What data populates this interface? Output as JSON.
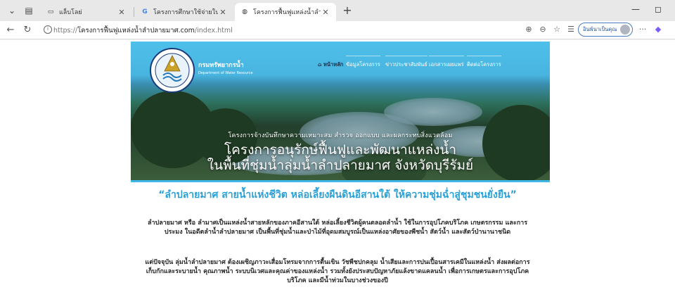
{
  "browser": {
    "tabs": [
      {
        "title": "แล็บโลย่",
        "active": false
      },
      {
        "title": "โครงการศึกษาใช้จ่ายในการศึกษาความเหมาะสม",
        "active": false
      },
      {
        "title": "โครงการฟื้นฟูแหล่งน้ำลำปลายมาศ",
        "active": true
      }
    ],
    "new_tab_glyph": "+",
    "url": {
      "scheme": "https://",
      "host": "โครงการฟื้นฟูแหล่งน้ำลำปลายมาศ.com",
      "path": "/index.html"
    },
    "profile_label": "อินพ้นาเป็นคุณ"
  },
  "site": {
    "brand_th": "กรมทรัพยากรน้ำ",
    "brand_en": "Department of Water Resource",
    "nav": [
      {
        "label": "หน้าหลัก",
        "home": true
      },
      {
        "label": "ข้อมูลโครงการ"
      },
      {
        "label": "ข่าวประชาสัมพันธ์"
      },
      {
        "label": "เอกสารเผยแพร่"
      },
      {
        "label": "ติดต่อโครงการ"
      }
    ],
    "caption_small": "โครงการจ้างบันทึกษาความเหมาะสม สำรวจ ออกแบบ และผลกระทบสิ่งแวดล้อม",
    "caption_line1": "โครงการอนุรักษ์ฟื้นฟูและพัฒนาแหล่งน้ำ",
    "caption_line2": "ในพื้นที่ชุ่มน้ำลุ่มน้ำลำปลายมาศ จังหวัดบุรีรัมย์",
    "headline": "“ลำปลายมาศ สายน้ำแห่งชีวิต หล่อเลี้ยงผืนดินอีสานใต้ ให้ความชุ่มฉ่ำสู่ชุมชนยั่งยืน”",
    "paragraph1": "ลำปลายมาศ หรือ ลำมาศเป็นแหล่งน้ำสายหลักของภาคอีสานใต้ หล่อเลี้ยงชีวิตผู้คนตลอดลำน้ำ ใช้ในการอุปโภคบริโภค เกษตรกรรม และการประมง ในอดีตลำน้ำลำปลายมาศ เป็นพื้นที่ชุ่มน้ำและป่าไม้ที่อุดมสมบูรณ์เป็นแหล่งอาศัยของพืชน้ำ สัตว์น้ำ และสัตว์ป่านานาชนิด",
    "paragraph2": "แต่ปัจจุบัน ลุ่มน้ำลำปลายมาศ ต้องเผชิญภาวะเสื่อมโทรมจากการตื้นเขิน วัชพืชปกคลุม น้ำเสียและการปนเปื้อนสารเคมีในแหล่งน้ำ ส่งผลต่อการเก็บกักและระบายน้ำ คุณภาพน้ำ ระบบนิเวศและคุณค่าของแหล่งน้ำ รวมทั้งยังประสบปัญหาภัยแล้งขาดแคลนน้ำ เพื่อการเกษตรและการอุปโภคบริโภค และมีน้ำท่วมในบางช่วงของปี"
  },
  "colors": {
    "accent": "#2aa1d6",
    "hero_sky": "#4ec0ea",
    "profile_border": "#4a7ac0"
  },
  "icons": [
    "chevron-down-icon",
    "tab-list-icon",
    "close-icon",
    "globe-icon",
    "back-icon",
    "reload-icon",
    "lock-icon",
    "zoom-icon",
    "settings-icon",
    "star-icon",
    "favorites-icon",
    "more-icon",
    "copilot-icon",
    "minimize-icon",
    "maximize-icon"
  ]
}
